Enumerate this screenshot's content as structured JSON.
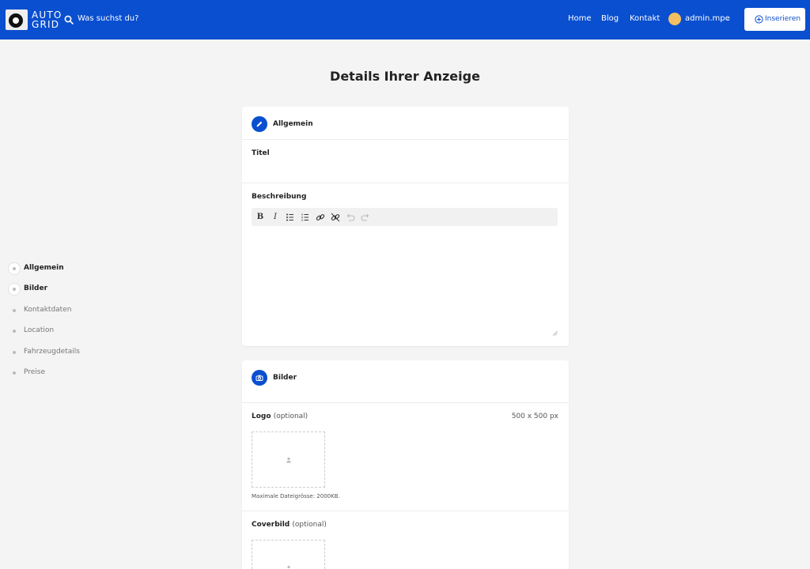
{
  "header": {
    "logo_top": "AUTO",
    "logo_bottom": "GRID",
    "search_placeholder": "Was suchst du?",
    "nav": [
      "Home",
      "Blog",
      "Kontakt"
    ],
    "user": "admin.mpe",
    "insert_label": "Inserieren",
    "colors": {
      "bar": "#0a4fcf",
      "avatar": "#f2c062"
    }
  },
  "page_title": "Details Ihrer Anzeige",
  "sidebar": {
    "items": [
      {
        "label": "Allgemein",
        "active": true
      },
      {
        "label": "Bilder",
        "active": true
      },
      {
        "label": "Kontaktdaten",
        "active": false
      },
      {
        "label": "Location",
        "active": false
      },
      {
        "label": "Fahrzeugdetails",
        "active": false
      },
      {
        "label": "Preise",
        "active": false
      }
    ]
  },
  "general": {
    "title": "Allgemein",
    "title_field_label": "Titel",
    "description_label": "Beschreibung",
    "toolbar": [
      "bold",
      "italic",
      "bullet-list",
      "numbered-list",
      "link",
      "unlink",
      "undo",
      "redo"
    ]
  },
  "images": {
    "title": "Bilder",
    "logo_label": "Logo",
    "optional": "(optional)",
    "logo_size": "500 x 500 px",
    "max_size_hint": "Maximale Dateigrösse: 2000KB.",
    "cover_label": "Coverbild"
  }
}
